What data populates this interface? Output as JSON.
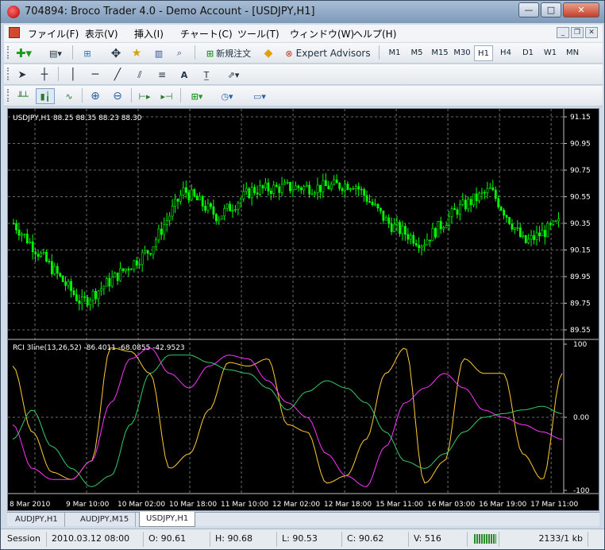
{
  "window": {
    "title": "704894: Broco Trader 4.0 - Demo Account - [USDJPY,H1]"
  },
  "menu": [
    "ファイル(F)",
    "表示(V)",
    "挿入(I)",
    "チャート(C)",
    "ツール(T)",
    "ウィンドウ(W)",
    "ヘルプ(H)"
  ],
  "toolbar1": {
    "new_order": "新規注文",
    "expert_advisors": "Expert Advisors"
  },
  "timeframes": [
    "M1",
    "M5",
    "M15",
    "M30",
    "H1",
    "H4",
    "D1",
    "W1",
    "MN"
  ],
  "active_timeframe": "H1",
  "toolbar2": {
    "text_tool": "A"
  },
  "price_chart": {
    "info": "USDJPY,H1  88.25 88.35 88.23 88.30",
    "y_ticks": [
      "91.15",
      "90.95",
      "90.75",
      "90.55",
      "90.35",
      "90.15",
      "89.95",
      "89.75",
      "89.55"
    ]
  },
  "indicator": {
    "info": "RCI 3line(13,26,52) -86.4011 -68.0855 -42.9523",
    "y_ticks": [
      "100",
      "0.00",
      "-100"
    ]
  },
  "x_ticks": [
    "8 Mar 2010",
    "9 Mar 10:00",
    "10 Mar 02:00",
    "10 Mar 18:00",
    "11 Mar 10:00",
    "12 Mar 02:00",
    "12 Mar 18:00",
    "15 Mar 11:00",
    "16 Mar 03:00",
    "16 Mar 19:00",
    "17 Mar 11:00"
  ],
  "chart_tabs": [
    "AUDJPY,H1",
    "AUDJPY,M15",
    "USDJPY,H1"
  ],
  "active_tab": "USDJPY,H1",
  "status": {
    "session": "Session",
    "datetime": "2010.03.12 08:00",
    "open": "O: 90.61",
    "high": "H: 90.68",
    "low": "L: 90.53",
    "close": "C: 90.62",
    "volume": "V: 516",
    "traffic": "2133/1 kb"
  },
  "colors": {
    "candle": "#00ff00",
    "chart_bg": "#000000",
    "grid": "#8a8a8a",
    "rci_short": "#ffcc33",
    "rci_mid": "#ff33ff",
    "rci_long": "#33cc66"
  },
  "chart_data": {
    "type": "line",
    "title": "USDJPY,H1",
    "price_ylim": [
      89.55,
      91.15
    ],
    "close_approx": [
      {
        "x": "8 Mar 2010",
        "y": 90.35
      },
      {
        "x": "8 Mar 18:00",
        "y": 90.05
      },
      {
        "x": "9 Mar 10:00",
        "y": 89.75
      },
      {
        "x": "9 Mar 20:00",
        "y": 89.95
      },
      {
        "x": "10 Mar 02:00",
        "y": 90.15
      },
      {
        "x": "10 Mar 06:00",
        "y": 90.6
      },
      {
        "x": "10 Mar 18:00",
        "y": 90.4
      },
      {
        "x": "11 Mar 10:00",
        "y": 90.6
      },
      {
        "x": "12 Mar 02:00",
        "y": 90.62
      },
      {
        "x": "12 Mar 08:00",
        "y": 90.62
      },
      {
        "x": "12 Mar 18:00",
        "y": 90.65
      },
      {
        "x": "15 Mar 11:00",
        "y": 90.35
      },
      {
        "x": "16 Mar 03:00",
        "y": 90.2
      },
      {
        "x": "16 Mar 19:00",
        "y": 90.45
      },
      {
        "x": "17 Mar 03:00",
        "y": 90.6
      },
      {
        "x": "17 Mar 11:00",
        "y": 90.2
      },
      {
        "x": "17 Mar 18:00",
        "y": 90.35
      }
    ],
    "indicator_ylim": [
      -100,
      100
    ],
    "series": [
      {
        "values": [
          70,
          -20,
          -75,
          -85,
          -60,
          95,
          90,
          60,
          -70,
          -50,
          10,
          75,
          70,
          80,
          -10,
          -20,
          -90,
          -80,
          -30,
          60,
          95,
          -90,
          -60,
          80,
          60,
          60,
          -50,
          -85,
          60
        ]
      },
      {
        "values": [
          -10,
          -70,
          -85,
          -85,
          -60,
          20,
          80,
          95,
          60,
          40,
          70,
          85,
          80,
          50,
          20,
          0,
          -50,
          -80,
          -95,
          -40,
          20,
          40,
          60,
          40,
          10,
          0,
          -10,
          -20,
          -30
        ]
      },
      {
        "values": [
          -30,
          10,
          -40,
          -70,
          -95,
          -80,
          -10,
          60,
          85,
          85,
          75,
          65,
          60,
          40,
          10,
          35,
          50,
          40,
          20,
          -20,
          -60,
          -70,
          -50,
          -20,
          0,
          5,
          10,
          15,
          5
        ]
      }
    ]
  }
}
